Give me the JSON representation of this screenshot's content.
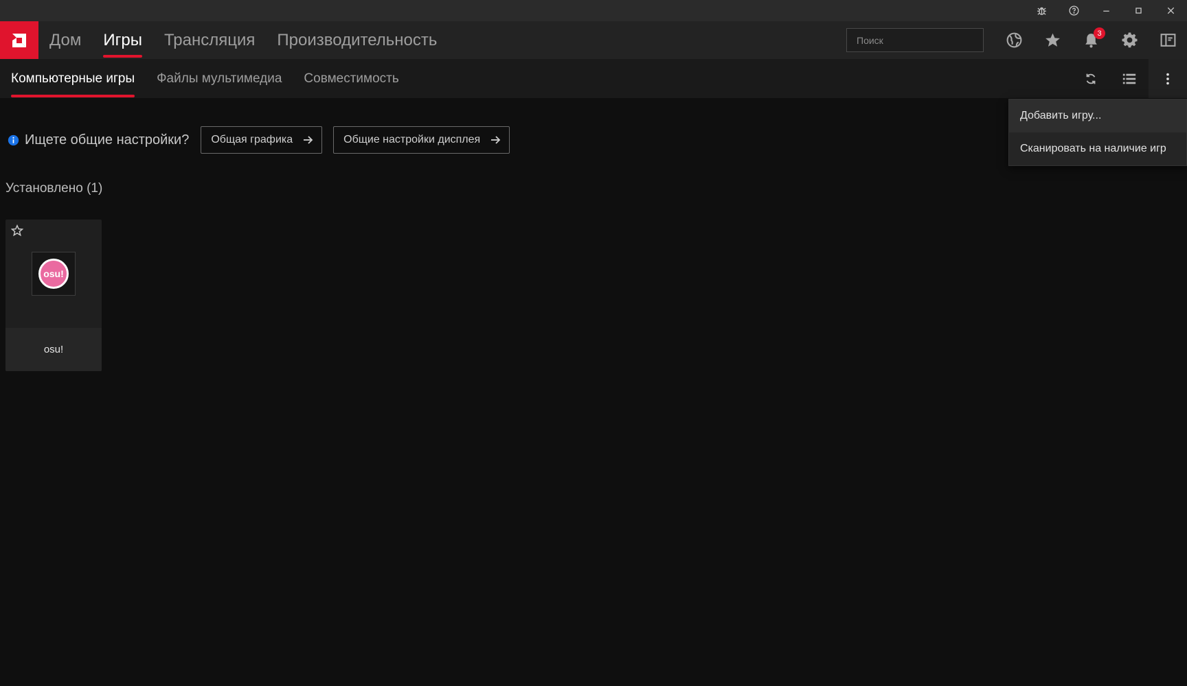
{
  "window": {
    "controls": [
      "bug-report",
      "help",
      "minimize",
      "maximize",
      "close"
    ]
  },
  "nav": {
    "items": [
      {
        "label": "Дом",
        "active": false
      },
      {
        "label": "Игры",
        "active": true
      },
      {
        "label": "Трансляция",
        "active": false
      },
      {
        "label": "Производительность",
        "active": false
      }
    ],
    "search_placeholder": "Поиск",
    "notification_count": "3",
    "icons": [
      "globe-icon",
      "star-icon",
      "bell-icon",
      "gear-icon",
      "sidebar-toggle-icon"
    ]
  },
  "subnav": {
    "tabs": [
      {
        "label": "Компьютерные игры",
        "active": true
      },
      {
        "label": "Файлы мультимедиа",
        "active": false
      },
      {
        "label": "Совместимость",
        "active": false
      }
    ]
  },
  "hint": {
    "text": "Ищете общие настройки?",
    "button_graphics": "Общая графика",
    "button_display": "Общие настройки дисплея"
  },
  "section": {
    "title": "Установлено (1)"
  },
  "games": [
    {
      "name": "osu!",
      "logo_text": "osu!"
    }
  ],
  "menu": {
    "items": [
      "Добавить игру...",
      "Сканировать на наличие игр"
    ]
  },
  "colors": {
    "accent": "#e0142d",
    "background": "#0f0f0f",
    "osu_pink": "#ea6aa0",
    "info_blue": "#1a73e8"
  }
}
